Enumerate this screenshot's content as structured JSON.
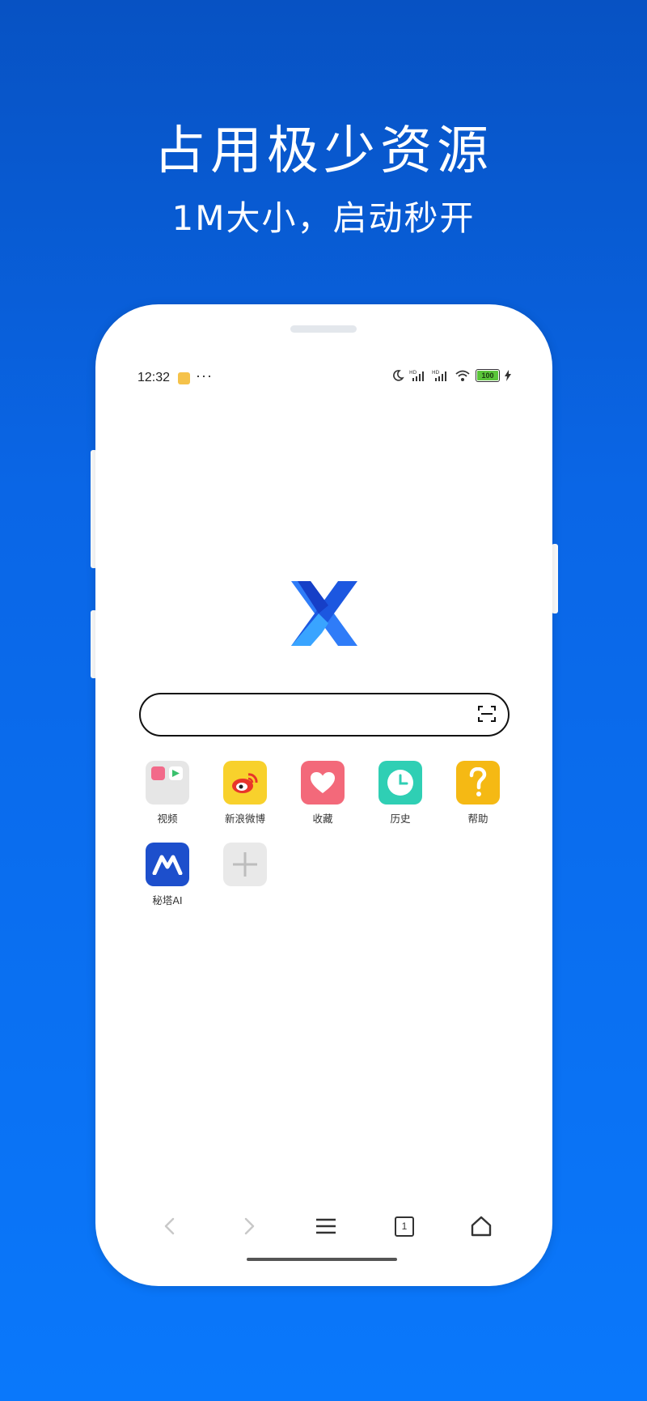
{
  "promo": {
    "title": "占用极少资源",
    "subtitle": "1M大小，启动秒开"
  },
  "status_bar": {
    "time": "12:32",
    "more": "···",
    "battery_level": "100"
  },
  "search": {
    "placeholder": ""
  },
  "shortcuts": [
    {
      "label": "视频",
      "icon": "video-folder-icon",
      "color": "#e6e6e6"
    },
    {
      "label": "新浪微博",
      "icon": "weibo-icon",
      "color": "#f8d12c"
    },
    {
      "label": "收藏",
      "icon": "heart-icon",
      "color": "#f3697a"
    },
    {
      "label": "历史",
      "icon": "clock-icon",
      "color": "#2fcfb4"
    },
    {
      "label": "帮助",
      "icon": "help-icon",
      "color": "#f5b914"
    },
    {
      "label": "秘塔AI",
      "icon": "metaso-ai-icon",
      "color": "#1d4fcc"
    },
    {
      "label": "",
      "icon": "add-shortcut-icon",
      "color": "#e9e9e9"
    }
  ],
  "bottom_nav": {
    "tab_count": "1"
  },
  "colors": {
    "background_top": "#0752c3",
    "background_bottom": "#0a78fb",
    "logo_blue": "#1f6ef5"
  }
}
